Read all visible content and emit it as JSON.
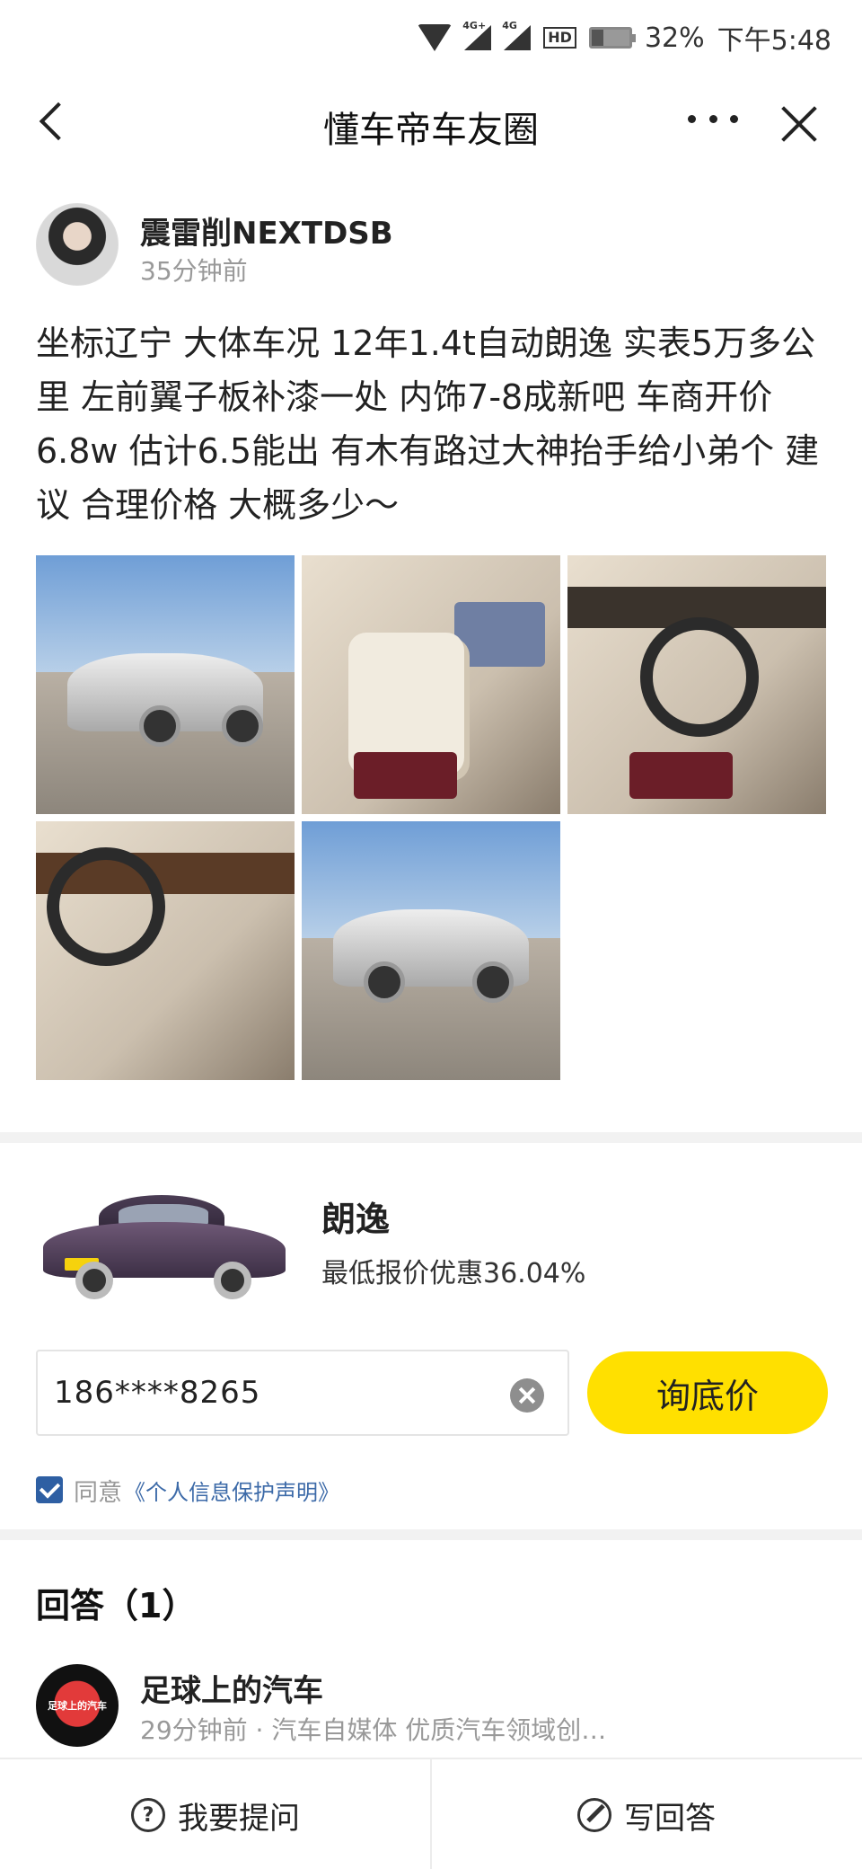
{
  "status_bar": {
    "net1": "4G+",
    "net2": "4G",
    "hd": "HD",
    "battery_level": 0.32,
    "battery": "32%",
    "time": "下午5:48"
  },
  "header": {
    "title": "懂车帝车友圈"
  },
  "post": {
    "author": "震雷削NEXTDSB",
    "time": "35分钟前",
    "text": "坐标辽宁 大体车况 12年1.4t自动朗逸 实表5万多公里 左前翼子板补漆一处 内饰7-8成新吧 车商开价6.8w 估计6.5能出 有木有路过大神抬手给小弟个 建议 合理价格 大概多少～"
  },
  "promo": {
    "model": "朗逸",
    "discount": "最低报价优惠36.04%",
    "phone_value": "186****8265",
    "button": "询底价",
    "agree_label": "同意",
    "privacy_link": "《个人信息保护声明》"
  },
  "answers": {
    "heading": "回答（1）",
    "items": [
      {
        "avatar_text": "足球上的汽车",
        "name": "足球上的汽车",
        "meta": "29分钟前 · 汽车自媒体 优质汽车领域创…"
      }
    ]
  },
  "bottom_bar": {
    "ask": "我要提问",
    "answer": "写回答"
  }
}
